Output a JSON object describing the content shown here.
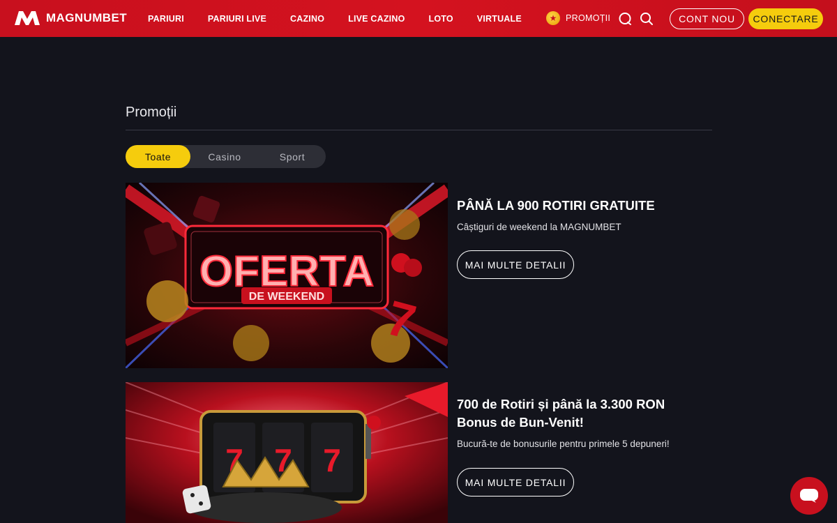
{
  "brand": {
    "name": "MAGNUMBET",
    "color": "#c8101e",
    "accent": "#f5cc0d"
  },
  "nav": {
    "items": [
      {
        "label": "PARIURI"
      },
      {
        "label": "PARIURI LIVE"
      },
      {
        "label": "CAZINO"
      },
      {
        "label": "LIVE CAZINO"
      },
      {
        "label": "LOTO"
      },
      {
        "label": "VIRTUALE"
      }
    ],
    "promotions_label": "PROMOȚII",
    "icons": [
      "star-icon",
      "chat-icon",
      "search-icon"
    ],
    "register_label": "CONT NOU",
    "login_label": "CONECTARE"
  },
  "page": {
    "title": "Promoții"
  },
  "filters": {
    "tabs": [
      {
        "label": "Toate",
        "active": true
      },
      {
        "label": "Casino",
        "active": false
      },
      {
        "label": "Sport",
        "active": false
      }
    ]
  },
  "promos": [
    {
      "banner_line1": "OFERTA",
      "banner_line2": "DE WEEKEND",
      "title": "PÂNĂ LA 900 ROTIRI GRATUITE",
      "subtitle": "Câștiguri de weekend la MAGNUMBET",
      "cta": "MAI MULTE DETALII"
    },
    {
      "reel_symbols": [
        "7",
        "7",
        "7"
      ],
      "title": "700 de Rotiri și până la 3.300 RON Bonus de Bun-Venit!",
      "subtitle": "Bucură-te de bonusurile pentru primele 5 depuneri!",
      "cta": "MAI MULTE DETALII"
    }
  ],
  "chat": {
    "icon": "chat-bubble-icon"
  }
}
